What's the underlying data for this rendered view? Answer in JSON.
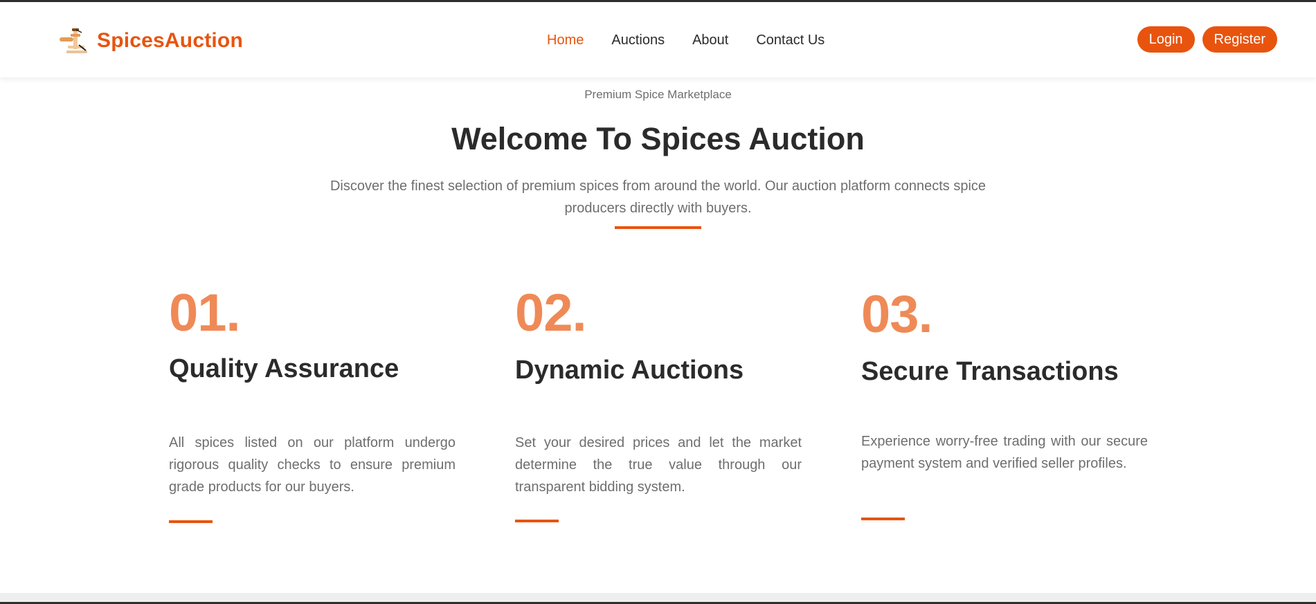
{
  "brand": {
    "name": "SpicesAuction",
    "icon": "gavel-icon"
  },
  "nav": {
    "links": [
      {
        "label": "Home",
        "active": true
      },
      {
        "label": "Auctions",
        "active": false
      },
      {
        "label": "About",
        "active": false
      },
      {
        "label": "Contact Us",
        "active": false
      }
    ]
  },
  "auth": {
    "login_label": "Login",
    "register_label": "Register"
  },
  "hero": {
    "eyebrow": "Premium Spice Marketplace",
    "title": "Welcome To Spices Auction",
    "description": "Discover the finest selection of premium spices from around the world. Our auction platform connects spice producers directly with buyers."
  },
  "features": [
    {
      "number": "01.",
      "title": "Quality Assurance",
      "description": "All spices listed on our platform undergo rigorous quality checks to ensure premium grade products for our buyers."
    },
    {
      "number": "02.",
      "title": "Dynamic Auctions",
      "description": "Set your desired prices and let the market determine the true value through our transparent bidding system."
    },
    {
      "number": "03.",
      "title": "Secure Transactions",
      "description": "Experience worry-free trading with our secure payment system and verified seller profiles."
    }
  ],
  "colors": {
    "accent": "#e8540e",
    "number": "#ef8a57",
    "text": "#2b2b2b",
    "muted": "#6e6e6e"
  }
}
